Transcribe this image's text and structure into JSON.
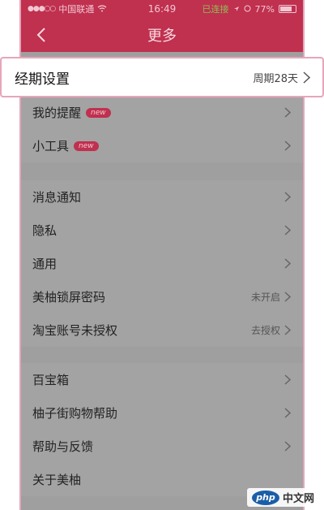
{
  "status_bar": {
    "signal": "●●●○○",
    "carrier": "中国联通",
    "time": "16:49",
    "right_badge": "已连接",
    "battery": "77%"
  },
  "navbar": {
    "title": "更多"
  },
  "period_setting": {
    "label": "经期设置",
    "value": "周期28天"
  },
  "group1": [
    {
      "label": "我的提醒",
      "badge": "new"
    },
    {
      "label": "小工具",
      "badge": "new"
    }
  ],
  "group2": [
    {
      "label": "消息通知"
    },
    {
      "label": "隐私"
    },
    {
      "label": "通用"
    },
    {
      "label": "美柚锁屏密码",
      "value": "未开启"
    },
    {
      "label": "淘宝账号未授权",
      "value": "去授权"
    }
  ],
  "group3": [
    {
      "label": "百宝箱"
    },
    {
      "label": "柚子街购物帮助"
    },
    {
      "label": "帮助与反馈"
    },
    {
      "label": "关于美柚"
    }
  ],
  "watermark": {
    "logo": "php",
    "text": "中文网"
  },
  "colors": {
    "header": "#c0304f",
    "badge": "#c0304f",
    "highlight_border": "#e7a5b9",
    "overlay_gray": "#9f9f9f"
  }
}
